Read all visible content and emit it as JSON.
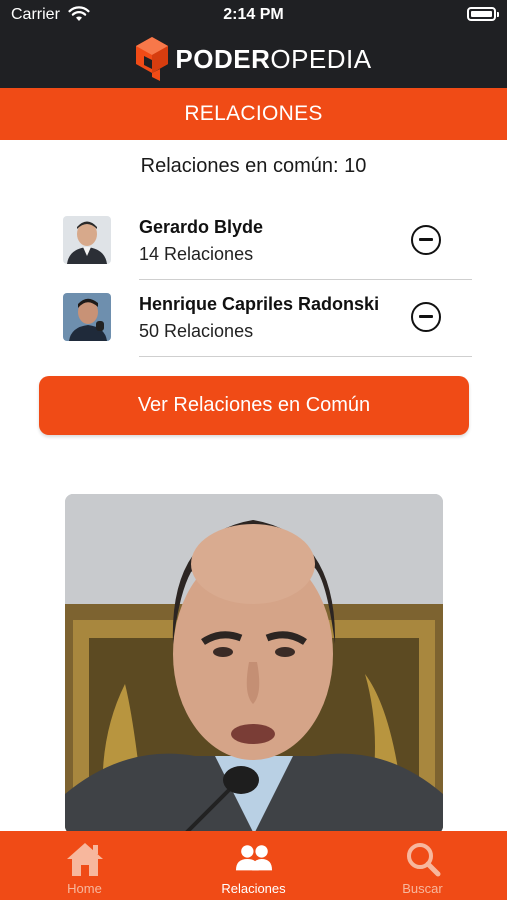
{
  "status_bar": {
    "carrier": "Carrier",
    "time": "2:14 PM"
  },
  "brand": {
    "name_bold": "PODER",
    "name_light": "OPEDIA"
  },
  "header": {
    "title": "RELACIONES"
  },
  "common": {
    "text": "Relaciones en común: 10"
  },
  "relations": [
    {
      "name": "Gerardo Blyde",
      "count": "14 Relaciones",
      "remove_icon": "minus-circle-icon"
    },
    {
      "name": "Henrique Capriles Radonski",
      "count": "50 Relaciones",
      "remove_icon": "minus-circle-icon"
    }
  ],
  "cta": {
    "label": "Ver Relaciones en Común"
  },
  "tab_bar": {
    "tabs": [
      {
        "label": "Home",
        "icon": "home-icon",
        "active": false
      },
      {
        "label": "Relaciones",
        "icon": "people-icon",
        "active": true
      },
      {
        "label": "Buscar",
        "icon": "search-icon",
        "active": false
      }
    ]
  },
  "colors": {
    "accent": "#f04b16",
    "header_dark": "#1f2023",
    "tab_inactive": "#f7b79d",
    "tab_active": "#ffffff"
  }
}
